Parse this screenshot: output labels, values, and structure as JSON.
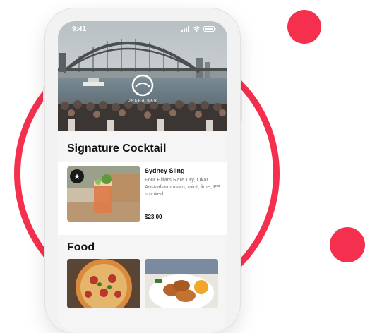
{
  "status_bar": {
    "time": "9:41"
  },
  "venue": {
    "logo_text": "OPERA BAR"
  },
  "signature": {
    "title": "Signature Cocktail",
    "item": {
      "name": "Sydney Sling",
      "description": "Four Pillars Rare Dry, Okar Australian amaro, mint, lime, PS smoked",
      "price": "$23.00"
    }
  },
  "food": {
    "title": "Food"
  },
  "colors": {
    "accent": "#f5304f"
  },
  "icons": [
    "signal-icon",
    "wifi-icon",
    "battery-icon",
    "star-icon"
  ]
}
